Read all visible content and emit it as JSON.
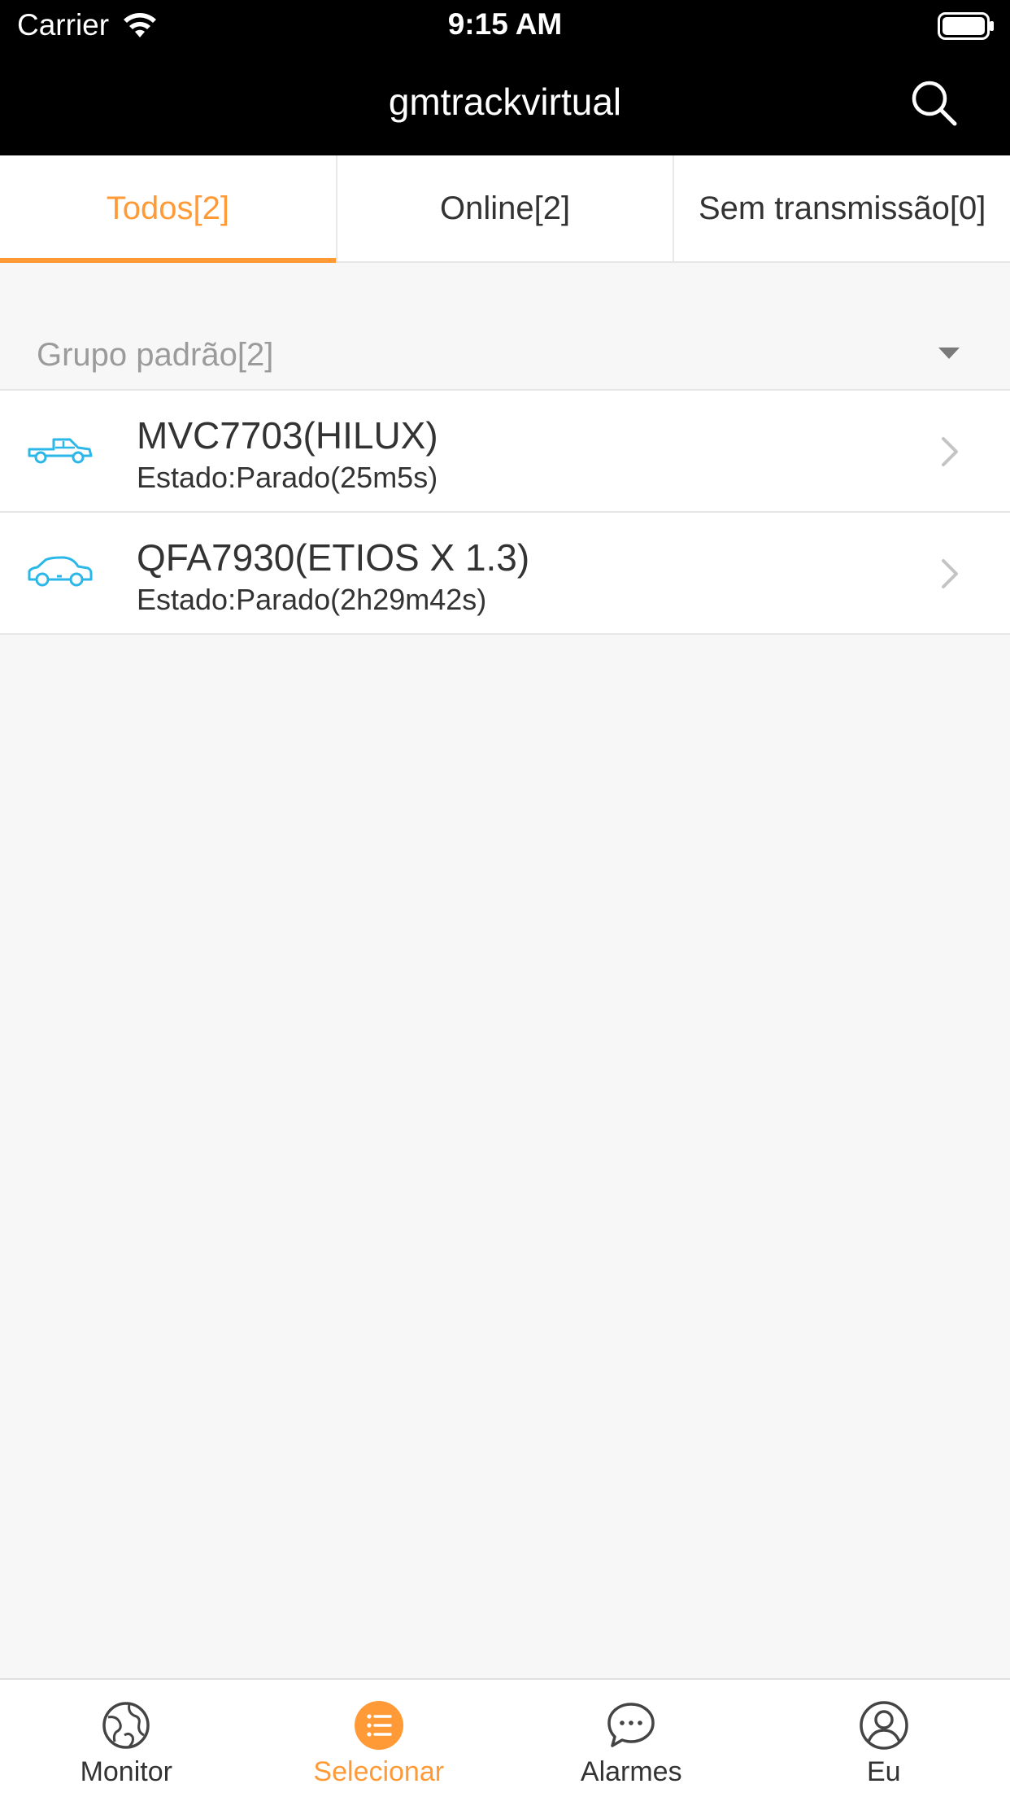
{
  "status_bar": {
    "carrier": "Carrier",
    "time": "9:15 AM"
  },
  "nav": {
    "title": "gmtrackvirtual",
    "search_icon": "search-icon"
  },
  "tabs": [
    {
      "label": "Todos[2]",
      "active": true
    },
    {
      "label": "Online[2]",
      "active": false
    },
    {
      "label": "Sem transmissão[0]",
      "active": false
    }
  ],
  "group": {
    "title": "Grupo padrão[2]",
    "icon": "caret-down-icon"
  },
  "vehicles": [
    {
      "name": "MVC7703(HILUX)",
      "status": "Estado:Parado(25m5s)",
      "icon": "pickup-truck-icon"
    },
    {
      "name": "QFA7930(ETIOS X 1.3)",
      "status": "Estado:Parado(2h29m42s)",
      "icon": "sedan-car-icon"
    }
  ],
  "tabbar": [
    {
      "label": "Monitor",
      "icon": "globe-icon",
      "active": false
    },
    {
      "label": "Selecionar",
      "icon": "list-icon",
      "active": true
    },
    {
      "label": "Alarmes",
      "icon": "chat-bubble-icon",
      "active": false
    },
    {
      "label": "Eu",
      "icon": "user-icon",
      "active": false
    }
  ],
  "colors": {
    "accent": "#ff9a36",
    "vehicle_icon": "#2bb7e8",
    "nav_bg": "#000000"
  }
}
